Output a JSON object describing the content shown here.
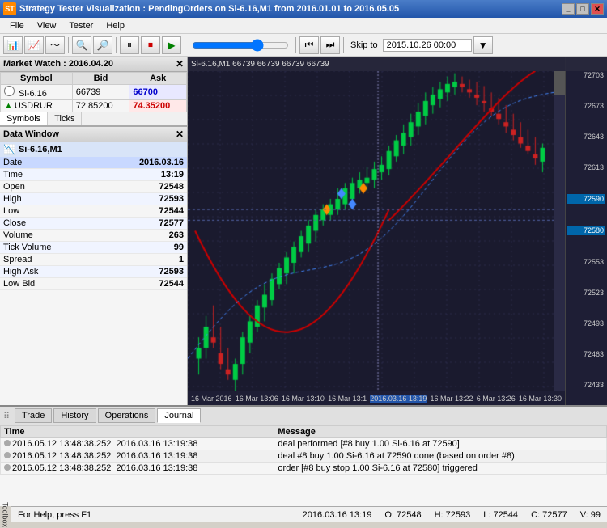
{
  "window": {
    "title": "Strategy Tester Visualization : PendingOrders on Si-6.16,M1 from 2016.01.01 to 2016.05.05",
    "icon": "ST"
  },
  "menu": {
    "items": [
      "File",
      "View",
      "Tester",
      "Help"
    ]
  },
  "toolbar": {
    "skip_label": "Skip to",
    "date_value": "2015.10.26 00:00"
  },
  "market_watch": {
    "title": "Market Watch : 2016.04.20",
    "columns": [
      "Symbol",
      "Bid",
      "Ask"
    ],
    "symbols": [
      {
        "name": "Si-6.16",
        "bid": "66739",
        "ask": "66700",
        "ask_style": "blue"
      },
      {
        "name": "USDRUR",
        "bid": "72.85200",
        "ask": "74.35200",
        "ask_style": "red"
      }
    ],
    "tabs": [
      "Symbols",
      "Ticks"
    ]
  },
  "data_window": {
    "title": "Data Window",
    "symbol": "Si-6.16,M1",
    "rows": [
      {
        "label": "Date",
        "value": "2016.03.16"
      },
      {
        "label": "Time",
        "value": "13:19"
      },
      {
        "label": "Open",
        "value": "72548"
      },
      {
        "label": "High",
        "value": "72593"
      },
      {
        "label": "Low",
        "value": "72544"
      },
      {
        "label": "Close",
        "value": "72577"
      },
      {
        "label": "Volume",
        "value": "263"
      },
      {
        "label": "Tick Volume",
        "value": "99"
      },
      {
        "label": "Spread",
        "value": "1"
      },
      {
        "label": "High Ask",
        "value": "72593"
      },
      {
        "label": "Low Bid",
        "value": "72544"
      }
    ]
  },
  "chart": {
    "symbol_info": "Si-6.16,M1  66739 66739 66739 66739",
    "price_levels": [
      "72703",
      "72673",
      "72643",
      "72613",
      "72590",
      "72580",
      "72553",
      "72523",
      "72493",
      "72463",
      "72433"
    ],
    "time_labels": [
      "16 Mar 2016",
      "16 Mar 13:06",
      "16 Mar 13:10",
      "16 Mar 13:1",
      "2016.03.16 13:19",
      "16 Mar 13:22",
      "6 Mar 13:26",
      "16 Mar 13:30"
    ]
  },
  "log": {
    "columns": [
      "Time",
      "Message"
    ],
    "rows": [
      {
        "time_left": "2016.05.12 13:48:38.252",
        "time_right": "2016.03.16 13:19:38",
        "message": "deal performed [#8 buy 1.00 Si-6.16 at 72590]"
      },
      {
        "time_left": "2016.05.12 13:48:38.252",
        "time_right": "2016.03.16 13:19:38",
        "message": "deal #8 buy 1.00 Si-6.16 at 72590 done (based on order #8)"
      },
      {
        "time_left": "2016.05.12 13:48:38.252",
        "time_right": "2016.03.16 13:19:38",
        "message": "order [#8 buy stop 1.00 Si-6.16 at 72580] triggered"
      }
    ]
  },
  "bottom_tabs": {
    "tabs": [
      "Trade",
      "History",
      "Operations",
      "Journal"
    ],
    "active": "Journal"
  },
  "status_bar": {
    "help_text": "For Help, press F1",
    "date": "2016.03.16 13:19",
    "open": "O: 72548",
    "high": "H: 72593",
    "low": "L: 72544",
    "close": "C: 72577",
    "volume": "V: 99"
  },
  "toolbox": {
    "label": "Toolbox"
  }
}
